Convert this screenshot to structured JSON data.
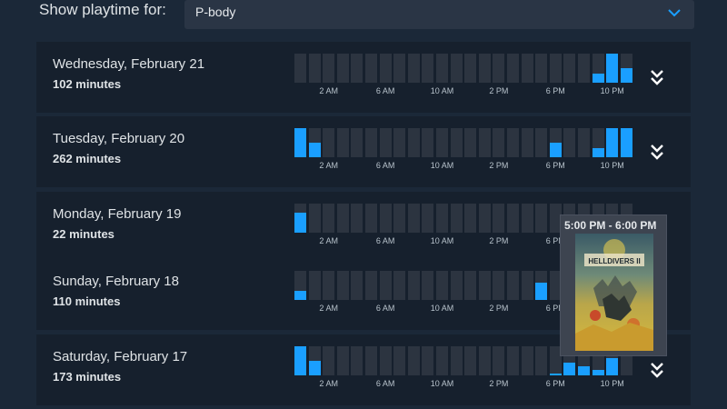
{
  "header": {
    "show_label": "Show playtime for:",
    "selected_user": "P-body",
    "dropdown_icon": "chevron-down-icon"
  },
  "colors": {
    "background": "#1b2838",
    "row_background": "#16202d",
    "slot_empty": "#2c3440",
    "bar_fill": "#1a9fff",
    "tooltip_background": "#3d4450"
  },
  "tick_labels": [
    "2 AM",
    "6 AM",
    "10 AM",
    "2 PM",
    "6 PM",
    "10 PM"
  ],
  "days": [
    {
      "date": "Wednesday, February 21",
      "minutes": "102 minutes",
      "hourly_fraction": [
        0,
        0,
        0,
        0,
        0,
        0,
        0,
        0,
        0,
        0,
        0,
        0,
        0,
        0,
        0,
        0,
        0,
        0,
        0,
        0,
        0,
        0.3,
        1.0,
        0.5
      ],
      "ticks_visible": [
        true,
        true,
        true,
        true,
        true,
        true
      ]
    },
    {
      "date": "Tuesday, February 20",
      "minutes": "262 minutes",
      "hourly_fraction": [
        1.0,
        0.5,
        0,
        0,
        0,
        0,
        0,
        0,
        0,
        0,
        0,
        0,
        0,
        0,
        0,
        0,
        0,
        0,
        0.5,
        0,
        0,
        0.3,
        1.0,
        1.0
      ],
      "ticks_visible": [
        true,
        true,
        true,
        true,
        true,
        true
      ]
    },
    {
      "date": "Monday, February 19",
      "minutes": "22 minutes",
      "hourly_fraction": [
        0.7,
        0,
        0,
        0,
        0,
        0,
        0,
        0,
        0,
        0,
        0,
        0,
        0,
        0,
        0,
        0,
        0,
        0,
        0,
        0,
        0,
        0,
        0,
        0
      ],
      "ticks_visible": [
        true,
        true,
        true,
        true,
        true,
        false
      ]
    },
    {
      "date": "Sunday, February 18",
      "minutes": "110 minutes",
      "hourly_fraction": [
        0.3,
        0,
        0,
        0,
        0,
        0,
        0,
        0,
        0,
        0,
        0,
        0,
        0,
        0,
        0,
        0,
        0,
        0.6,
        0,
        0,
        0,
        0,
        0,
        0
      ],
      "ticks_visible": [
        true,
        true,
        true,
        true,
        true,
        false
      ]
    },
    {
      "date": "Saturday, February 17",
      "minutes": "173 minutes",
      "hourly_fraction": [
        1.0,
        0.5,
        0,
        0,
        0,
        0,
        0,
        0,
        0,
        0,
        0,
        0,
        0,
        0,
        0,
        0,
        0,
        0,
        0.05,
        0.45,
        0.3,
        0.2,
        0.6,
        0
      ],
      "ticks_visible": [
        true,
        true,
        true,
        true,
        true,
        true
      ]
    }
  ],
  "tooltip": {
    "time_range": "5:00 PM - 6:00 PM",
    "game_title": "HELLDIVERS II"
  }
}
